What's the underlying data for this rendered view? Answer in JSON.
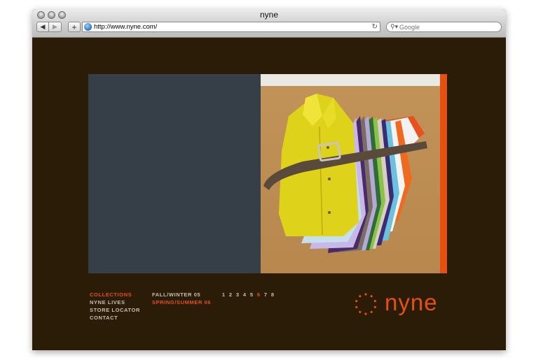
{
  "window": {
    "title": "nyne"
  },
  "toolbar": {
    "back_icon": "back-arrow-icon",
    "forward_icon": "forward-arrow-icon",
    "add_bookmark_icon": "plus-icon",
    "url": "http://www.nyne.com/",
    "search_placeholder": "Google"
  },
  "site": {
    "menu": [
      {
        "label": "COLLECTIONS",
        "active": true
      },
      {
        "label": "NYNE LIVES",
        "active": false
      },
      {
        "label": "STORE LOCATOR",
        "active": false
      },
      {
        "label": "CONTACT",
        "active": false
      }
    ],
    "seasons": [
      {
        "label": "FALL/WINTER 05",
        "active": false
      },
      {
        "label": "SPRING/SUMMER 06",
        "active": true
      }
    ],
    "pages": [
      "1",
      "2",
      "3",
      "4",
      "5",
      "6",
      "7",
      "8"
    ],
    "active_page": "6",
    "logo_text": "nyne"
  },
  "colors": {
    "accent": "#e6510f",
    "background": "#2b1c08",
    "panel": "#363f47",
    "menu_text": "#c9bfae"
  }
}
